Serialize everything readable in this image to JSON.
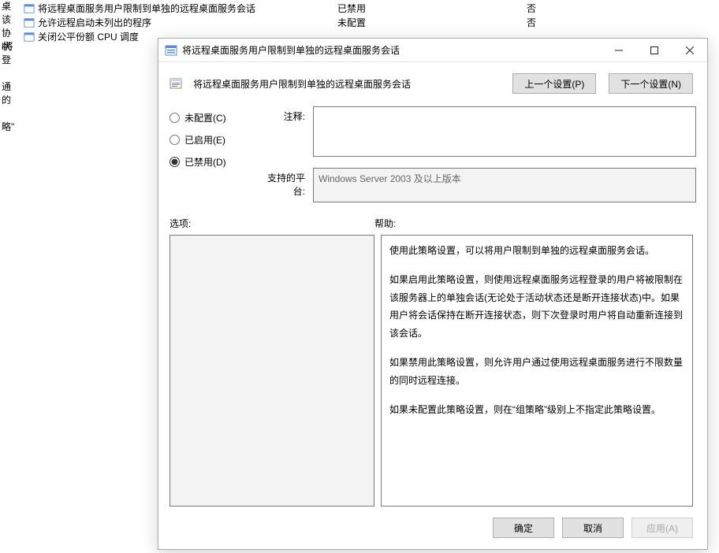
{
  "bg_rows": [
    {
      "name": "将远程桌面服务用户限制到单独的远程桌面服务会话",
      "state": "已禁用",
      "comment": "否"
    },
    {
      "name": "允许远程启动未列出的程序",
      "state": "未配置",
      "comment": "否"
    },
    {
      "name": "关闭公平份额 CPU 调度",
      "state": "",
      "comment": ""
    }
  ],
  "bg_fragments": [
    "桌",
    "该",
    "协状",
    "i将",
    "登",
    "",
    "通",
    "的",
    "",
    "略\""
  ],
  "dialog": {
    "title": "将远程桌面服务用户限制到单独的远程桌面服务会话",
    "header_title": "将远程桌面服务用户限制到单独的远程桌面服务会话",
    "prev_btn": "上一个设置(P)",
    "next_btn": "下一个设置(N)",
    "radios": {
      "not_configured": "未配置(C)",
      "enabled": "已启用(E)",
      "disabled": "已禁用(D)",
      "selected": "disabled"
    },
    "comment_label": "注释:",
    "comment_value": "",
    "supported_label": "支持的平台:",
    "supported_value": "Windows Server 2003 及以上版本",
    "options_label": "选项:",
    "help_label": "帮助:",
    "help_paragraphs": [
      "使用此策略设置，可以将用户限制到单独的远程桌面服务会话。",
      "如果启用此策略设置，则使用远程桌面服务远程登录的用户将被限制在该服务器上的单独会话(无论处于活动状态还是断开连接状态)中。如果用户将会话保持在断开连接状态，则下次登录时用户将自动重新连接到该会话。",
      "如果禁用此策略设置，则允许用户通过使用远程桌面服务进行不限数量的同时远程连接。",
      "如果未配置此策略设置，则在“组策略”级别上不指定此策略设置。"
    ],
    "buttons": {
      "ok": "确定",
      "cancel": "取消",
      "apply": "应用(A)"
    }
  }
}
